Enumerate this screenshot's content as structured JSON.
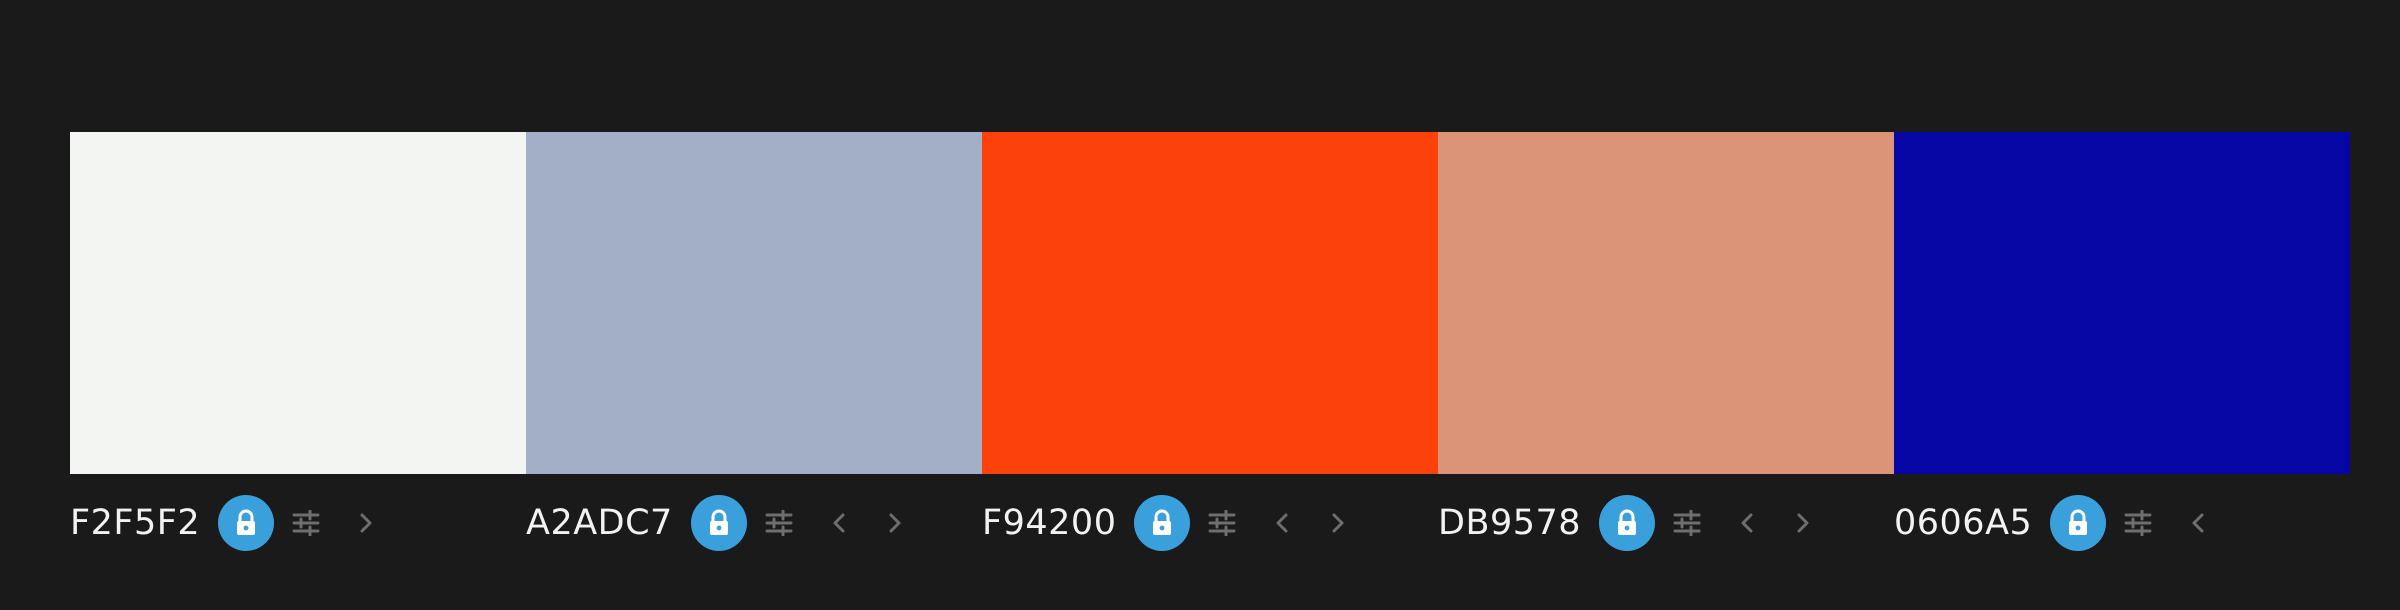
{
  "palette": {
    "colors": [
      {
        "hex": "F2F2F2",
        "label": "F2F5F2",
        "locked": true,
        "has_prev": false,
        "has_next": true
      },
      {
        "hex": "A2ADC7",
        "label": "A2ADC7",
        "locked": true,
        "has_prev": true,
        "has_next": true
      },
      {
        "hex": "F94200",
        "label": "F94200",
        "locked": true,
        "has_prev": true,
        "has_next": true
      },
      {
        "hex": "DB9578",
        "label": "DB9578",
        "locked": true,
        "has_prev": true,
        "has_next": true
      },
      {
        "hex": "0606A5",
        "label": "0606A5",
        "locked": true,
        "has_prev": true,
        "has_next": false
      }
    ],
    "colors_actual": [
      "#F2F5F2",
      "#A2AFC7",
      "#FC420A",
      "#DC9478",
      "#0606A5"
    ]
  },
  "theme": {
    "background": "#1A1A1A",
    "lock_button": "#3AA0DC",
    "icon_muted": "#6E6E6E",
    "text": "#F2F2F2"
  },
  "icons": {
    "lock": "lock-icon",
    "adjust": "sliders-icon",
    "prev": "chevron-left-icon",
    "next": "chevron-right-icon"
  }
}
